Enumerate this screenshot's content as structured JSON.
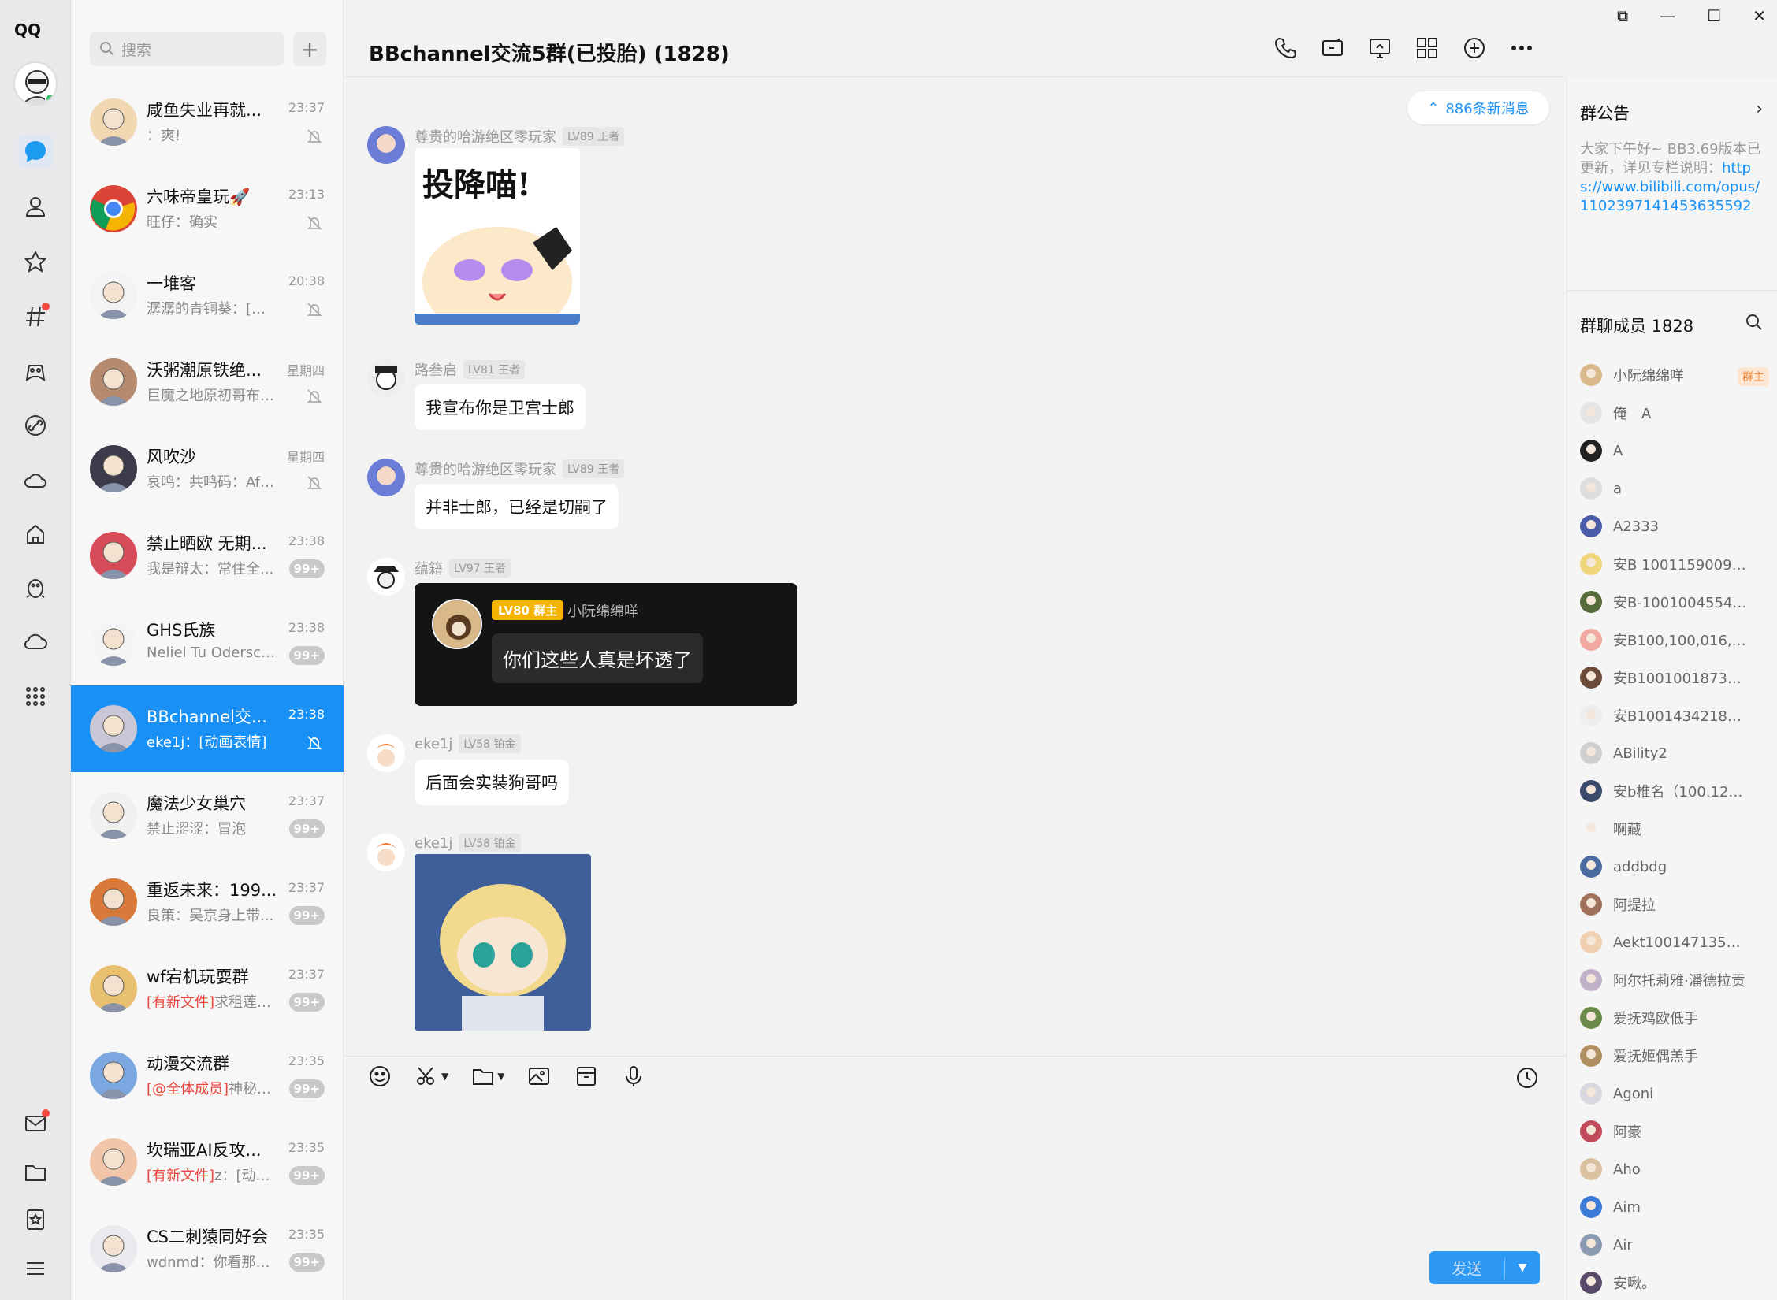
{
  "app": {
    "logo_text": "QQ"
  },
  "rail": {
    "icons": [
      "chat-icon",
      "contacts-icon",
      "favorite-icon",
      "channel-icon",
      "game-icon",
      "link-icon",
      "weather-icon",
      "shop-icon",
      "penguin-icon",
      "cloud-icon",
      "apps-icon"
    ],
    "bottom_icons": [
      "mail-icon",
      "folder-icon",
      "bookmark-icon",
      "menu-icon"
    ]
  },
  "search": {
    "placeholder": "搜索",
    "add": "+"
  },
  "conversations": [
    {
      "name": "咸鱼失业再就...",
      "time": "23:37",
      "preview": "：爽!",
      "muted": true,
      "badge": "",
      "tag": ""
    },
    {
      "name": "六味帝皇玩🚀",
      "time": "23:13",
      "preview": "旺仔：确实",
      "muted": true,
      "badge": "",
      "tag": ""
    },
    {
      "name": "一堆客",
      "time": "20:38",
      "preview": "潺潺的青铜葵：[图片]",
      "muted": true,
      "badge": "",
      "tag": ""
    },
    {
      "name": "沃粥潮原铁绝...",
      "time": "星期四",
      "preview": "巨魔之地原初哥布林：...",
      "muted": true,
      "badge": "",
      "tag": ""
    },
    {
      "name": "风吹沙",
      "time": "星期四",
      "preview": "哀鸣：共鸣码：AfQiJA...",
      "muted": true,
      "badge": "",
      "tag": ""
    },
    {
      "name": "禁止晒欧 无期...",
      "time": "23:38",
      "preview": "我是辩太：常住全...",
      "muted": false,
      "badge": "99+",
      "tag": ""
    },
    {
      "name": "GHS氏族",
      "time": "23:38",
      "preview": "Neliel Tu Odersch...",
      "muted": false,
      "badge": "99+",
      "tag": ""
    },
    {
      "name": "BBchannel交...",
      "time": "23:38",
      "preview": "eke1j：[动画表情]",
      "muted": true,
      "badge": "",
      "tag": ""
    },
    {
      "name": "魔法少女巢穴",
      "time": "23:37",
      "preview": "禁止涩涩：冒泡",
      "muted": false,
      "badge": "99+",
      "tag": ""
    },
    {
      "name": "重返未来：199...",
      "time": "23:37",
      "preview": "良策：吴京身上带...",
      "muted": false,
      "badge": "99+",
      "tag": ""
    },
    {
      "name": "wf宕机玩耍群",
      "time": "23:37",
      "preview": "求租莲花...",
      "muted": false,
      "badge": "99+",
      "tag": "[有新文件]"
    },
    {
      "name": "动漫交流群",
      "time": "23:35",
      "preview": "神秘靓...",
      "muted": false,
      "badge": "99+",
      "tag": "[@全体成员]"
    },
    {
      "name": "坎瑞亚AI反攻...",
      "time": "23:35",
      "preview": "z：[动画...",
      "muted": false,
      "badge": "99+",
      "tag": "[有新文件]"
    },
    {
      "name": "CS二刺猿同好会",
      "time": "23:35",
      "preview": "wdnmd：你看那配色",
      "muted": false,
      "badge": "99+",
      "tag": ""
    }
  ],
  "chat": {
    "title": "BBchannel交流5群(已投胎) (1828)",
    "new_messages": "886条新消息",
    "header_icons": [
      "phone-icon",
      "video-icon",
      "screen-share-icon",
      "apps-grid-icon",
      "add-circle-icon",
      "more-icon"
    ],
    "messages": [
      {
        "sender": "尊贵的哈游绝区零玩家",
        "level": "LV89 王者",
        "type": "sticker",
        "sticker_text": "投降喵!"
      },
      {
        "sender": "路叁启",
        "level": "LV81 王者",
        "type": "text",
        "text": "我宣布你是卫宫士郎"
      },
      {
        "sender": "尊贵的哈游绝区零玩家",
        "level": "LV89 王者",
        "type": "text",
        "text": "并非士郎，已经是切嗣了"
      },
      {
        "sender": "蕴籍",
        "level": "LV97 王者",
        "type": "quote",
        "quote_level": "LV80 群主",
        "quote_name": "小阮绵绵咩",
        "quote_text": "你们这些人真是坏透了"
      },
      {
        "sender": "eke1j",
        "level": "LV58 铂金",
        "type": "text",
        "text": "后面会实装狗哥吗"
      },
      {
        "sender": "eke1j",
        "level": "LV58 铂金",
        "type": "sticker",
        "sticker_text": ""
      }
    ],
    "toolbar_icons": [
      "emoji-icon",
      "scissors-icon",
      "folder-icon",
      "image-icon",
      "box-icon",
      "mic-icon"
    ],
    "send_label": "发送"
  },
  "panel": {
    "announcement_title": "群公告",
    "announcement_text": "大家下午好~ BB3.69版本已更新，详见专栏说明：",
    "announcement_link": "https://www.bilibili.com/opus/1102397141453635592",
    "members_title": "群聊成员 1828",
    "owner_label": "群主",
    "members": [
      "小阮绵绵咩",
      "俺　A",
      "A",
      "a",
      "A2333",
      "安B 100115900961 ...",
      "安B-100100455410",
      "安B100,100,016,720",
      "安B100100187317...",
      "安B100143421800 ...",
      "ABility2",
      "安b椎名（100.123.8...",
      "啊藏",
      "addbdg",
      "阿提拉",
      "Aekt100147135205",
      "阿尔托莉雅·潘德拉贡",
      "爱抚鸡欧低手",
      "爱抚姬偶羔手",
      "Agoni",
      "阿豪",
      "Aho",
      "Aim",
      "Air",
      "安啾。"
    ]
  }
}
